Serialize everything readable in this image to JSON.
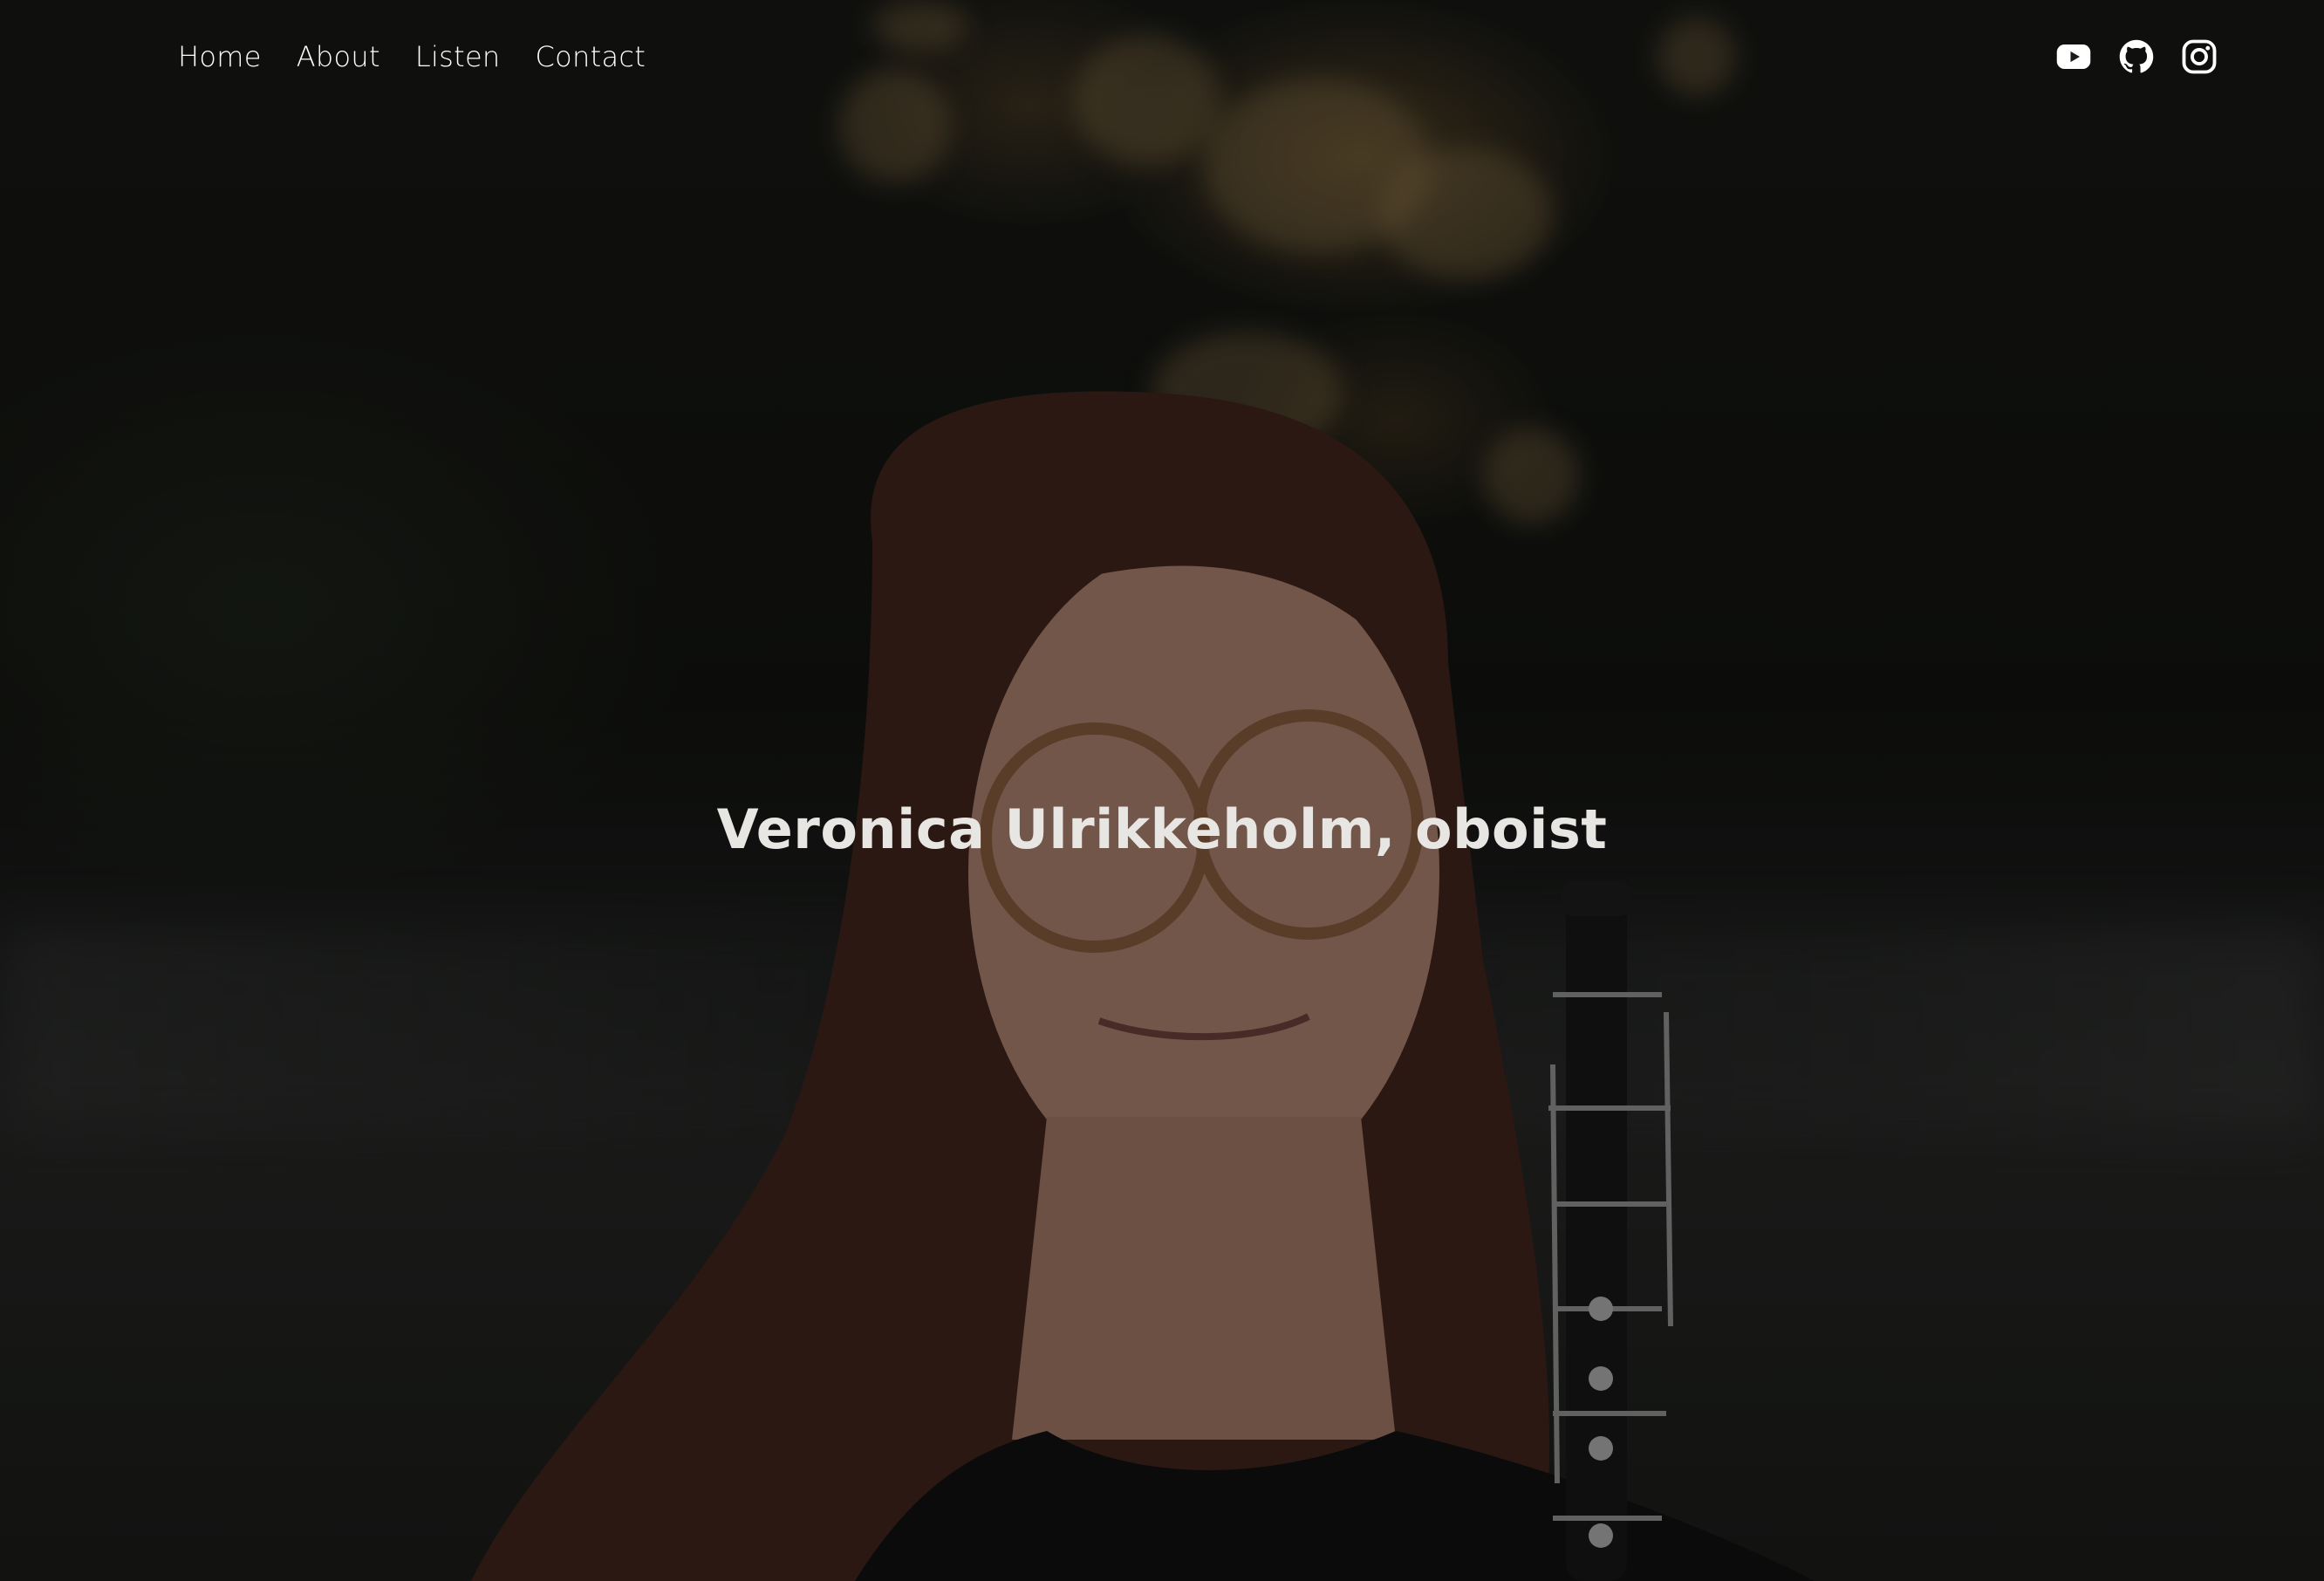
{
  "nav": {
    "items": [
      {
        "label": "Home"
      },
      {
        "label": "About"
      },
      {
        "label": "Listen"
      },
      {
        "label": "Contact"
      }
    ]
  },
  "social": {
    "icons": [
      "youtube-icon",
      "github-icon",
      "instagram-icon"
    ]
  },
  "hero": {
    "title": "Veronica Ulrikkeholm, oboist"
  },
  "colors": {
    "text": "#ffffff",
    "title": "#e8e6e3",
    "overlay": "rgba(0,0,0,0.42)"
  }
}
